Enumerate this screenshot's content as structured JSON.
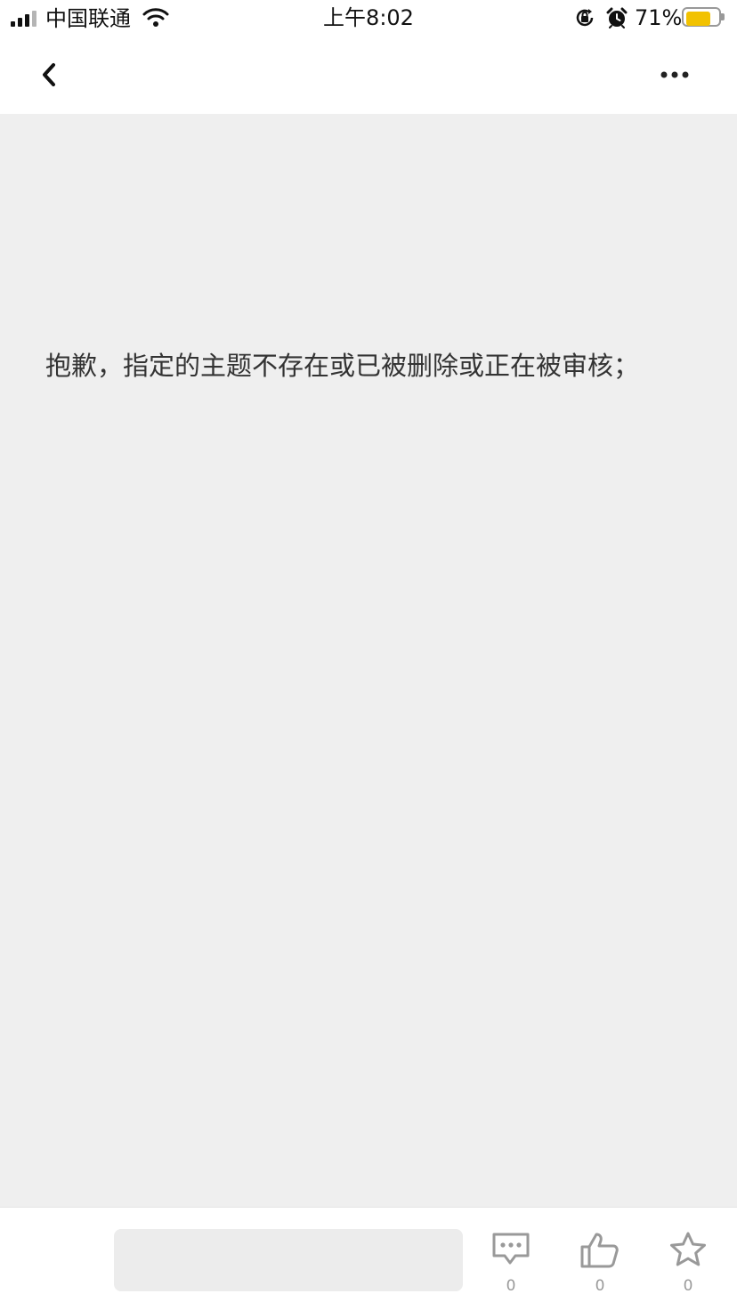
{
  "status_bar": {
    "carrier": "中国联通",
    "time": "上午8:02",
    "battery": "71%",
    "battery_level": 0.71
  },
  "nav": {
    "back_icon": "chevron-left",
    "more_icon": "ellipsis"
  },
  "content": {
    "message": "抱歉，指定的主题不存在或已被删除或正在被审核；"
  },
  "bottom_bar": {
    "actions": [
      {
        "icon": "comment",
        "count": "0"
      },
      {
        "icon": "like",
        "count": "0"
      },
      {
        "icon": "star",
        "count": "0"
      }
    ]
  },
  "colors": {
    "background": "#efefef",
    "battery": "#f2c200",
    "icon": "#999999"
  }
}
